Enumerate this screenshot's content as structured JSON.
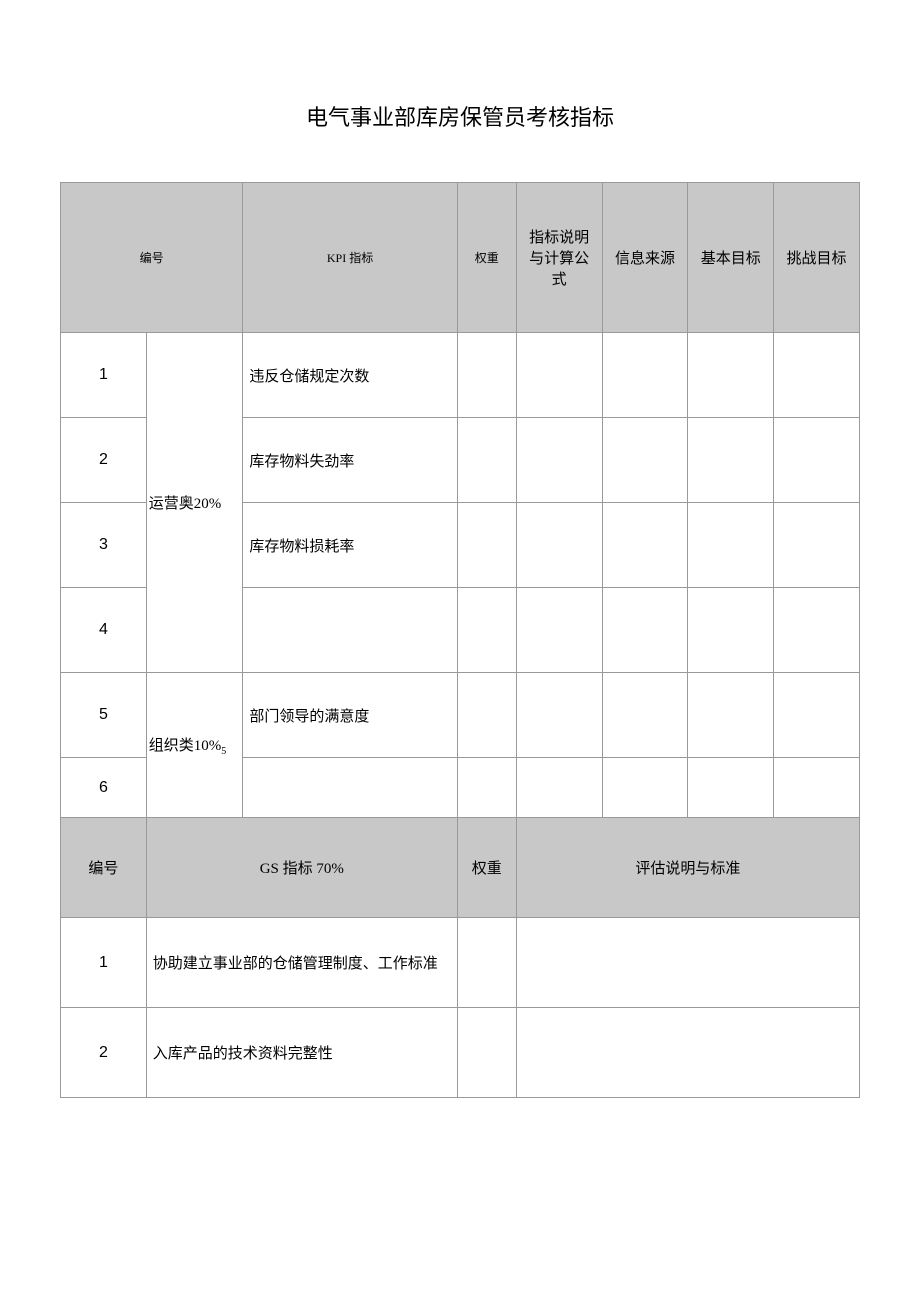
{
  "title": "电气事业部库房保管员考核指标",
  "headers": {
    "num": "编号",
    "kpi": "KPI 指标",
    "weight": "权重",
    "desc": "指标说明与计算公式",
    "source": "信息来源",
    "base": "基本目标",
    "challenge": "挑战目标"
  },
  "categories": {
    "operations": "运营奥20%",
    "organization": "组织类10%",
    "org_sub": "5"
  },
  "kpi_rows": [
    {
      "num": "1",
      "kpi": "违反仓储规定次数"
    },
    {
      "num": "2",
      "kpi": "库存物料失劲率"
    },
    {
      "num": "3",
      "kpi": "库存物料损耗率"
    },
    {
      "num": "4",
      "kpi": ""
    },
    {
      "num": "5",
      "kpi": "部门领导的满意度"
    },
    {
      "num": "6",
      "kpi": ""
    }
  ],
  "gs_headers": {
    "num": "编号",
    "gs": "GS 指标 70%",
    "weight": "权重",
    "eval": "评估说明与标准"
  },
  "gs_rows": [
    {
      "num": "1",
      "gs": "协助建立事业部的仓储管理制度、工作标准"
    },
    {
      "num": "2",
      "gs": "入库产品的技术资料完整性"
    }
  ]
}
